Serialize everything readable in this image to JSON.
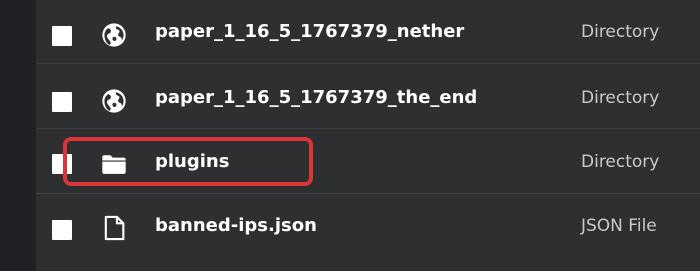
{
  "file_list": {
    "rows": [
      {
        "name": "paper_1_16_5_1767379_nether",
        "type": "Directory",
        "icon": "globe-icon"
      },
      {
        "name": "paper_1_16_5_1767379_the_end",
        "type": "Directory",
        "icon": "globe-icon"
      },
      {
        "name": "plugins",
        "type": "Directory",
        "icon": "folder-icon"
      },
      {
        "name": "banned-ips.json",
        "type": "JSON File",
        "icon": "file-icon"
      }
    ]
  },
  "colors": {
    "background": "#2e2f31",
    "left_strip": "#202124",
    "highlight": "#d9353b",
    "text": "#ffffff",
    "type_text": "#c9c9c9"
  }
}
